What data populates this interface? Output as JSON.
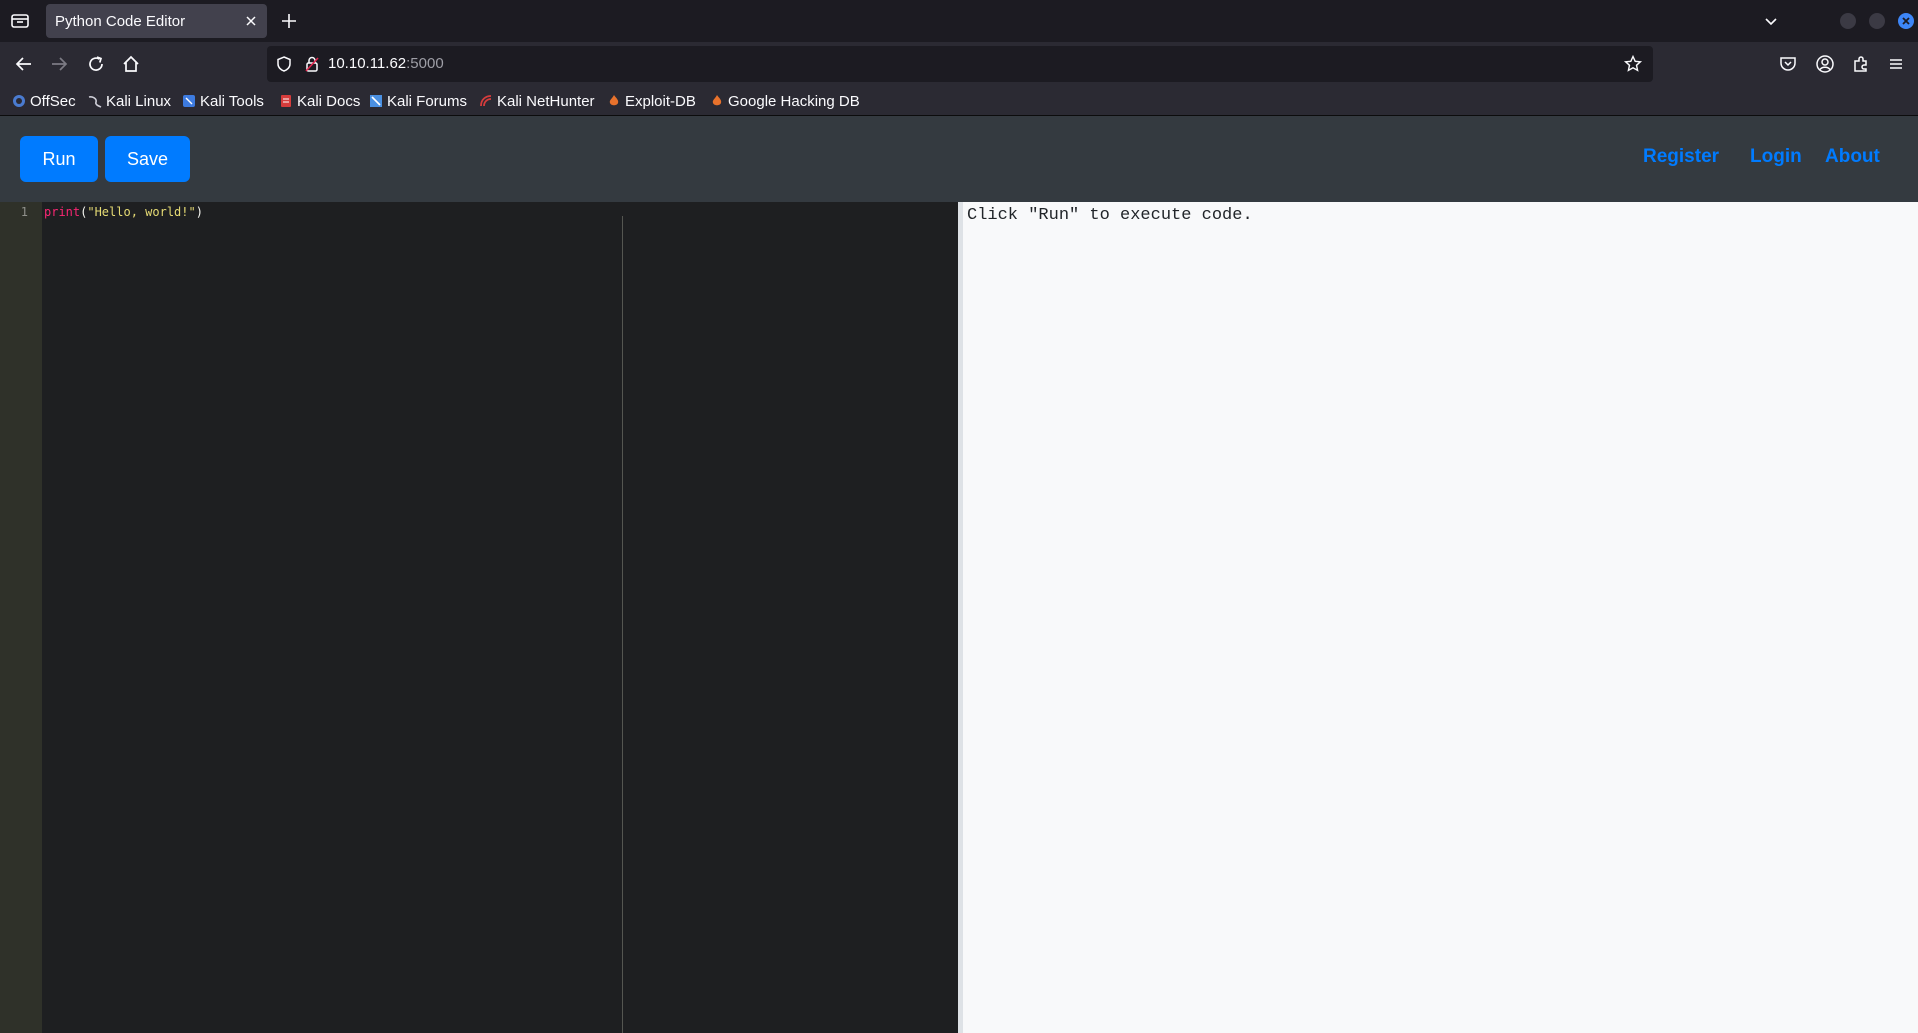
{
  "browser": {
    "tab": {
      "title": "Python Code Editor"
    },
    "url": {
      "host": "10.10.11.62",
      "port": ":5000"
    },
    "bookmarks": [
      {
        "label": "OffSec",
        "icon": "offsec-icon",
        "color": "#4a7bd0"
      },
      {
        "label": "Kali Linux",
        "icon": "kali-dragon-icon",
        "color": "#cfcfd8"
      },
      {
        "label": "Kali Tools",
        "icon": "kali-tools-icon",
        "color": "#3d7be0"
      },
      {
        "label": "Kali Docs",
        "icon": "kali-docs-icon",
        "color": "#d63c3c"
      },
      {
        "label": "Kali Forums",
        "icon": "kali-forums-icon",
        "color": "#4a90e2"
      },
      {
        "label": "Kali NetHunter",
        "icon": "kali-nethunter-icon",
        "color": "#d63c3c"
      },
      {
        "label": "Exploit-DB",
        "icon": "exploit-db-icon",
        "color": "#e8722c"
      },
      {
        "label": "Google Hacking DB",
        "icon": "ghdb-icon",
        "color": "#e8722c"
      }
    ]
  },
  "app": {
    "buttons": {
      "run": "Run",
      "save": "Save"
    },
    "nav": {
      "register": "Register",
      "login": "Login",
      "about": "About"
    },
    "editor": {
      "line_number": "1",
      "code": {
        "fn": "print",
        "open": "(",
        "str": "\"Hello, world!\"",
        "close": ")"
      }
    },
    "output": {
      "text": "Click \"Run\" to execute code."
    },
    "colors": {
      "accent": "#007bff",
      "header": "#343a40",
      "editor_bg": "#1e1f21",
      "output_bg": "#f8f9fa"
    }
  }
}
